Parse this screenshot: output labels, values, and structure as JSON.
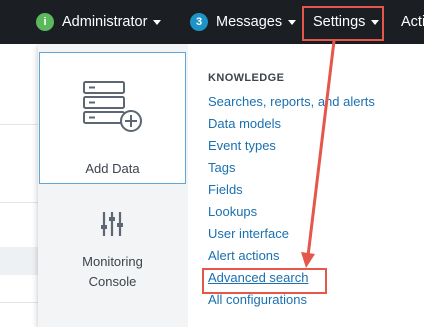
{
  "topbar": {
    "admin_badge_icon": "info-circle-icon",
    "admin_label": "Administrator",
    "messages_count": "3",
    "messages_label": "Messages",
    "settings_label": "Settings",
    "activity_label": "Acti"
  },
  "settings_menu": {
    "add_data_icon": "database-add-icon",
    "add_data_label": "Add Data",
    "monitoring_icon": "sliders-icon",
    "monitoring_line1": "Monitoring",
    "monitoring_line2": "Console",
    "section_heading": "KNOWLEDGE",
    "links": [
      "Searches, reports, and alerts",
      "Data models",
      "Event types",
      "Tags",
      "Fields",
      "Lookups",
      "User interface",
      "Alert actions",
      "Advanced search",
      "All configurations"
    ]
  },
  "colors": {
    "topbar_bg": "#1b1e23",
    "link": "#1a70b0",
    "highlight": "#e5564b",
    "admin_badge": "#5cb85c",
    "messages_badge": "#1e93c6"
  }
}
